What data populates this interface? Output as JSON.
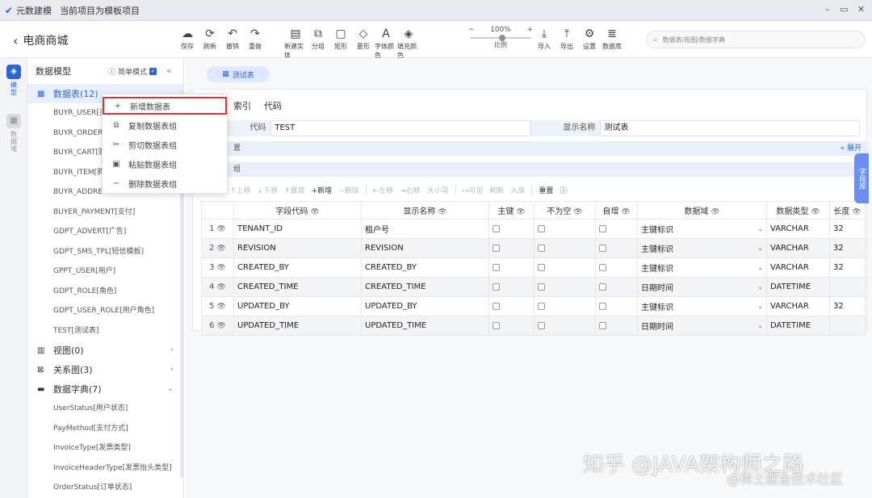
{
  "window": {
    "app_name": "元数建模",
    "subtitle": "当前项目为模板项目"
  },
  "toolbar": {
    "back_label": "电商商城",
    "buttons": [
      {
        "label": "保存",
        "icon": "cloud-upload-icon",
        "glyph": "☁",
        "dim": false
      },
      {
        "label": "刷新",
        "icon": "refresh-icon",
        "glyph": "⟳",
        "dim": false
      },
      {
        "label": "撤销",
        "icon": "undo-icon",
        "glyph": "↶",
        "dim": false
      },
      {
        "label": "重做",
        "icon": "redo-icon",
        "glyph": "↷",
        "dim": false
      }
    ],
    "draw_buttons": [
      {
        "label": "新建实体",
        "icon": "new-entity-icon",
        "glyph": "▤"
      },
      {
        "label": "分组",
        "icon": "group-icon",
        "glyph": "⧉"
      },
      {
        "label": "矩形",
        "icon": "rect-icon",
        "glyph": "▢"
      },
      {
        "label": "菱形",
        "icon": "diamond-icon",
        "glyph": "◇"
      },
      {
        "label": "字体颜色",
        "icon": "font-color-icon",
        "glyph": "A"
      },
      {
        "label": "填充颜色",
        "icon": "fill-color-icon",
        "glyph": "◈"
      }
    ],
    "zoom": {
      "value": "100%",
      "label": "比例"
    },
    "right_buttons": [
      {
        "label": "导入",
        "icon": "import-icon",
        "glyph": "⤓"
      },
      {
        "label": "导出",
        "icon": "export-icon",
        "glyph": "⤒"
      },
      {
        "label": "设置",
        "icon": "gear-icon",
        "glyph": "⚙"
      },
      {
        "label": "数据库",
        "icon": "database-icon",
        "glyph": "≣"
      }
    ],
    "search_placeholder": "数据表/视图/数据字典"
  },
  "rail": {
    "items": [
      {
        "label": "模型",
        "active": true
      },
      {
        "label": "数据域",
        "active": false
      }
    ]
  },
  "sidebar": {
    "title": "数据模型",
    "simple_mode": "简单模式",
    "groups": {
      "tables": {
        "label": "数据表(12)",
        "items": [
          "BUYR_USER[买",
          "BUYR_ORDER[",
          "BUYR_CART[购",
          "BUYR_ITEM[购",
          "BUYR_ADDRESS",
          "BUYER_PAYMENT[支付]",
          "GDPT_ADVERT[广告]",
          "GDPT_SMS_TPL[短信模板]",
          "GPPT_USER[用户]",
          "GDPT_ROLE[角色]",
          "GDPT_USER_ROLE[用户角色]",
          "TEST[测试表]"
        ]
      },
      "views": {
        "label": "视图(0)"
      },
      "diagrams": {
        "label": "关系图(3)"
      },
      "dicts": {
        "label": "数据字典(7)",
        "items": [
          "UserStatus[用户状态]",
          "PayMethod[支付方式]",
          "InvoiceType[发票类型]",
          "InvoiceHeaderType[发票抬头类型]",
          "OrderStatus[订单状态]"
        ]
      }
    }
  },
  "context_menu": {
    "items": [
      "新增数据表",
      "复制数据表组",
      "剪切数据表组",
      "粘贴数据表组",
      "删除数据表组"
    ]
  },
  "main": {
    "tab": "测试表",
    "subtabs": [
      "索引",
      "代码"
    ],
    "code_label": "代码",
    "code_value": "TEST",
    "display_label": "显示名称",
    "display_value": "测试表",
    "section1": "置",
    "section1_right": "« 展开",
    "section2": "组",
    "grid_toolbar": [
      "↑上移",
      "↓下移",
      "↟置底",
      "+新增",
      "−删除",
      "⇤左移",
      "⇥右移",
      "大小写",
      "↦可见",
      "刷新",
      "入库",
      "重置"
    ],
    "side_tab": "字段库",
    "columns": [
      "字段代码",
      "显示名称",
      "主键",
      "不为空",
      "自增",
      "数据域",
      "数据类型",
      "长度"
    ],
    "rows": [
      {
        "n": "1",
        "code": "TENANT_ID",
        "name": "租户号",
        "domain": "主键标识",
        "type": "VARCHAR",
        "len": "32"
      },
      {
        "n": "2",
        "code": "REVISION",
        "name": "REVISION",
        "domain": "主键标识",
        "type": "VARCHAR",
        "len": "32"
      },
      {
        "n": "3",
        "code": "CREATED_BY",
        "name": "CREATED_BY",
        "domain": "主键标识",
        "type": "VARCHAR",
        "len": "32"
      },
      {
        "n": "4",
        "code": "CREATED_TIME",
        "name": "CREATED_TIME",
        "domain": "日期时间",
        "type": "DATETIME",
        "len": ""
      },
      {
        "n": "5",
        "code": "UPDATED_BY",
        "name": "UPDATED_BY",
        "domain": "主键标识",
        "type": "VARCHAR",
        "len": "32"
      },
      {
        "n": "6",
        "code": "UPDATED_TIME",
        "name": "UPDATED_TIME",
        "domain": "日期时间",
        "type": "DATETIME",
        "len": ""
      }
    ]
  },
  "watermarks": [
    "知乎 @JAVA架构师之路",
    "@稀土掘金技术社区"
  ]
}
